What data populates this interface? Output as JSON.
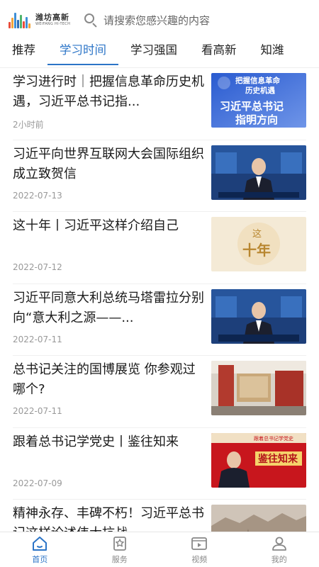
{
  "header": {
    "logo_cn": "潍坊高新",
    "logo_en": "WEIFANG HI-TECH",
    "search_placeholder": "请搜索您感兴趣的内容"
  },
  "tabs": [
    {
      "label": "推荐"
    },
    {
      "label": "学习时间",
      "active": true
    },
    {
      "label": "学习强国"
    },
    {
      "label": "看高新"
    },
    {
      "label": "知潍"
    }
  ],
  "articles": [
    {
      "title": "学习进行时｜把握信息革命历史机遇，习近平总书记指...",
      "meta": "2小时前",
      "thumb_text": [
        "把握信息革命",
        "历史机遇",
        "习近平总书记",
        "指明方向"
      ]
    },
    {
      "title": "习近平向世界互联网大会国际组织成立致贺信",
      "meta": "2022-07-13"
    },
    {
      "title": "这十年丨习近平这样介绍自己",
      "meta": "2022-07-12",
      "thumb_text": [
        "这",
        "十年"
      ]
    },
    {
      "title": "习近平同意大利总统马塔雷拉分别向“意大利之源——...",
      "meta": "2022-07-11"
    },
    {
      "title": "总书记关注的国博展览 你参观过哪个?",
      "meta": "2022-07-11"
    },
    {
      "title": "跟着总书记学党史丨鉴往知来",
      "meta": "2022-07-09",
      "thumb_text": [
        "跟着总书记学党史",
        "鉴往知来"
      ]
    },
    {
      "title": "精神永存、丰碑不朽！习近平总书记这样论述伟大抗战...",
      "meta": ""
    }
  ],
  "bottom_nav": [
    {
      "label": "首页",
      "icon": "home-icon",
      "active": true
    },
    {
      "label": "服务",
      "icon": "service-icon"
    },
    {
      "label": "视频",
      "icon": "video-icon"
    },
    {
      "label": "我的",
      "icon": "user-icon"
    }
  ],
  "colors": {
    "accent": "#2b74c7",
    "muted": "#999999"
  }
}
